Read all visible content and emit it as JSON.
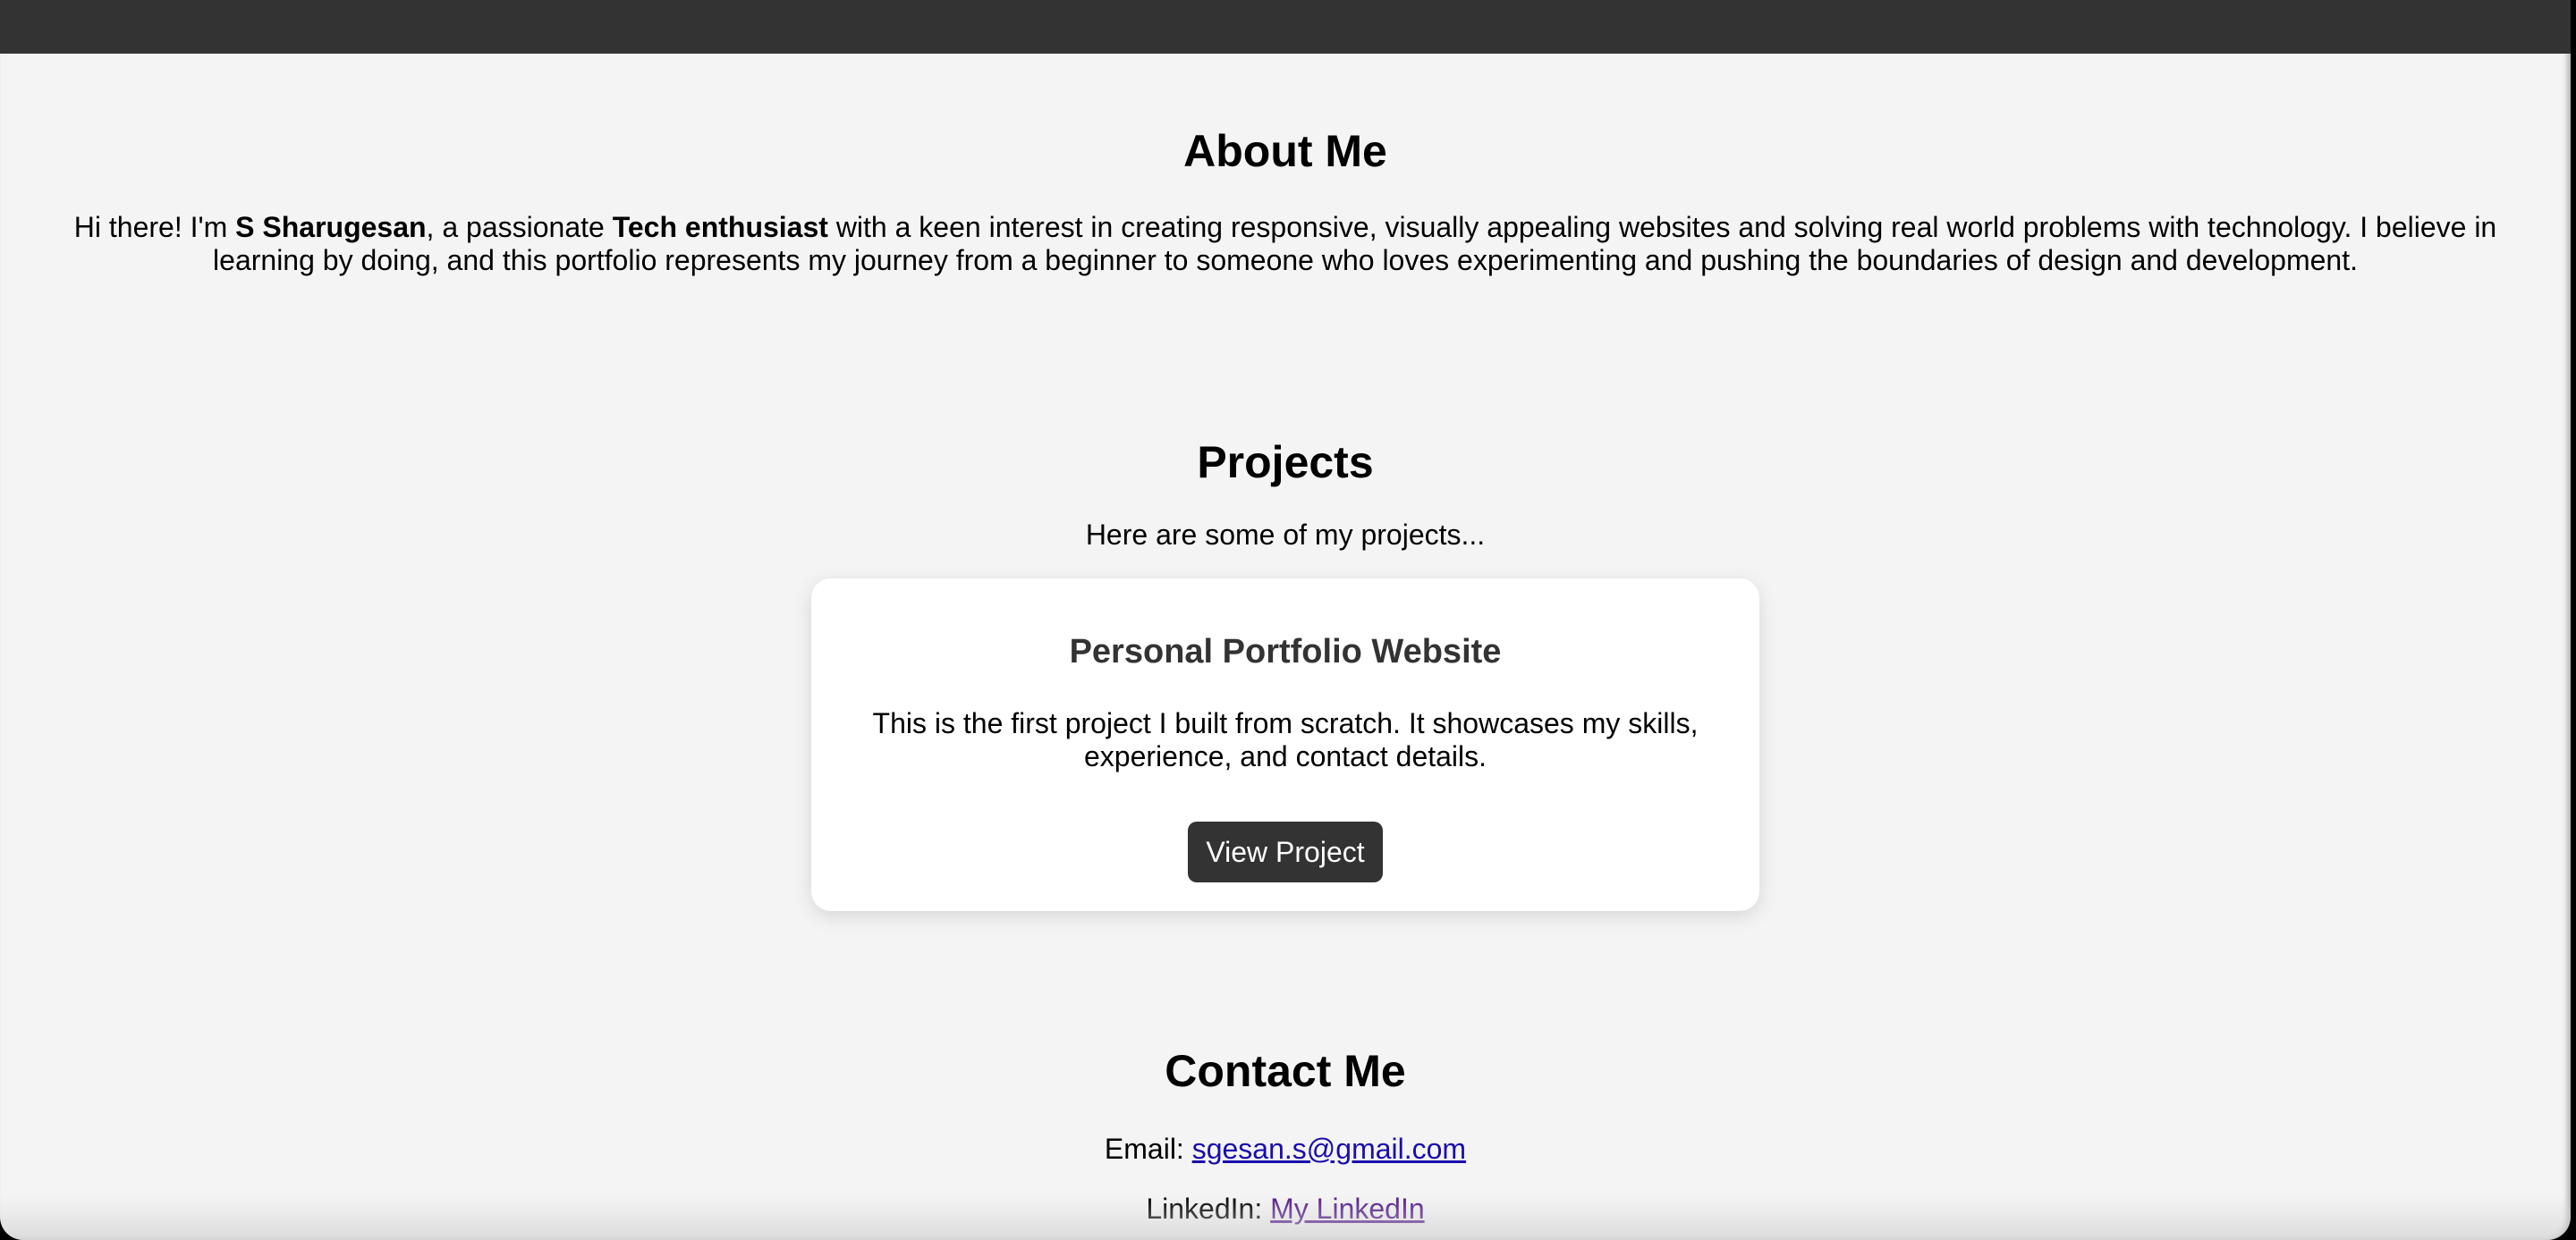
{
  "about": {
    "title": "About Me",
    "intro_pre": "Hi there! I'm ",
    "name": "S Sharugesan",
    "intro_mid": ", a passionate ",
    "role": "Tech enthusiast",
    "intro_post": " with a keen interest in creating responsive, visually appealing websites and solving real world problems with technology. I believe in learning by doing, and this portfolio represents my journey from a beginner to someone who loves experimenting and pushing the boundaries of design and development."
  },
  "projects": {
    "title": "Projects",
    "intro": "Here are some of my projects...",
    "items": [
      {
        "title": "Personal Portfolio Website",
        "description": "This is the first project I built from scratch. It showcases my skills, experience, and contact details.",
        "button_label": "View Project"
      }
    ]
  },
  "contact": {
    "title": "Contact Me",
    "email_label": "Email: ",
    "email": "sgesan.s@gmail.com",
    "linkedin_label": "LinkedIn: ",
    "linkedin_text": "My LinkedIn"
  },
  "colors": {
    "header_bg": "#333333",
    "page_bg": "#f4f4f4",
    "card_bg": "#ffffff",
    "button_bg": "#333333",
    "link": "#1a0dab",
    "visited_link": "#551a8b"
  }
}
